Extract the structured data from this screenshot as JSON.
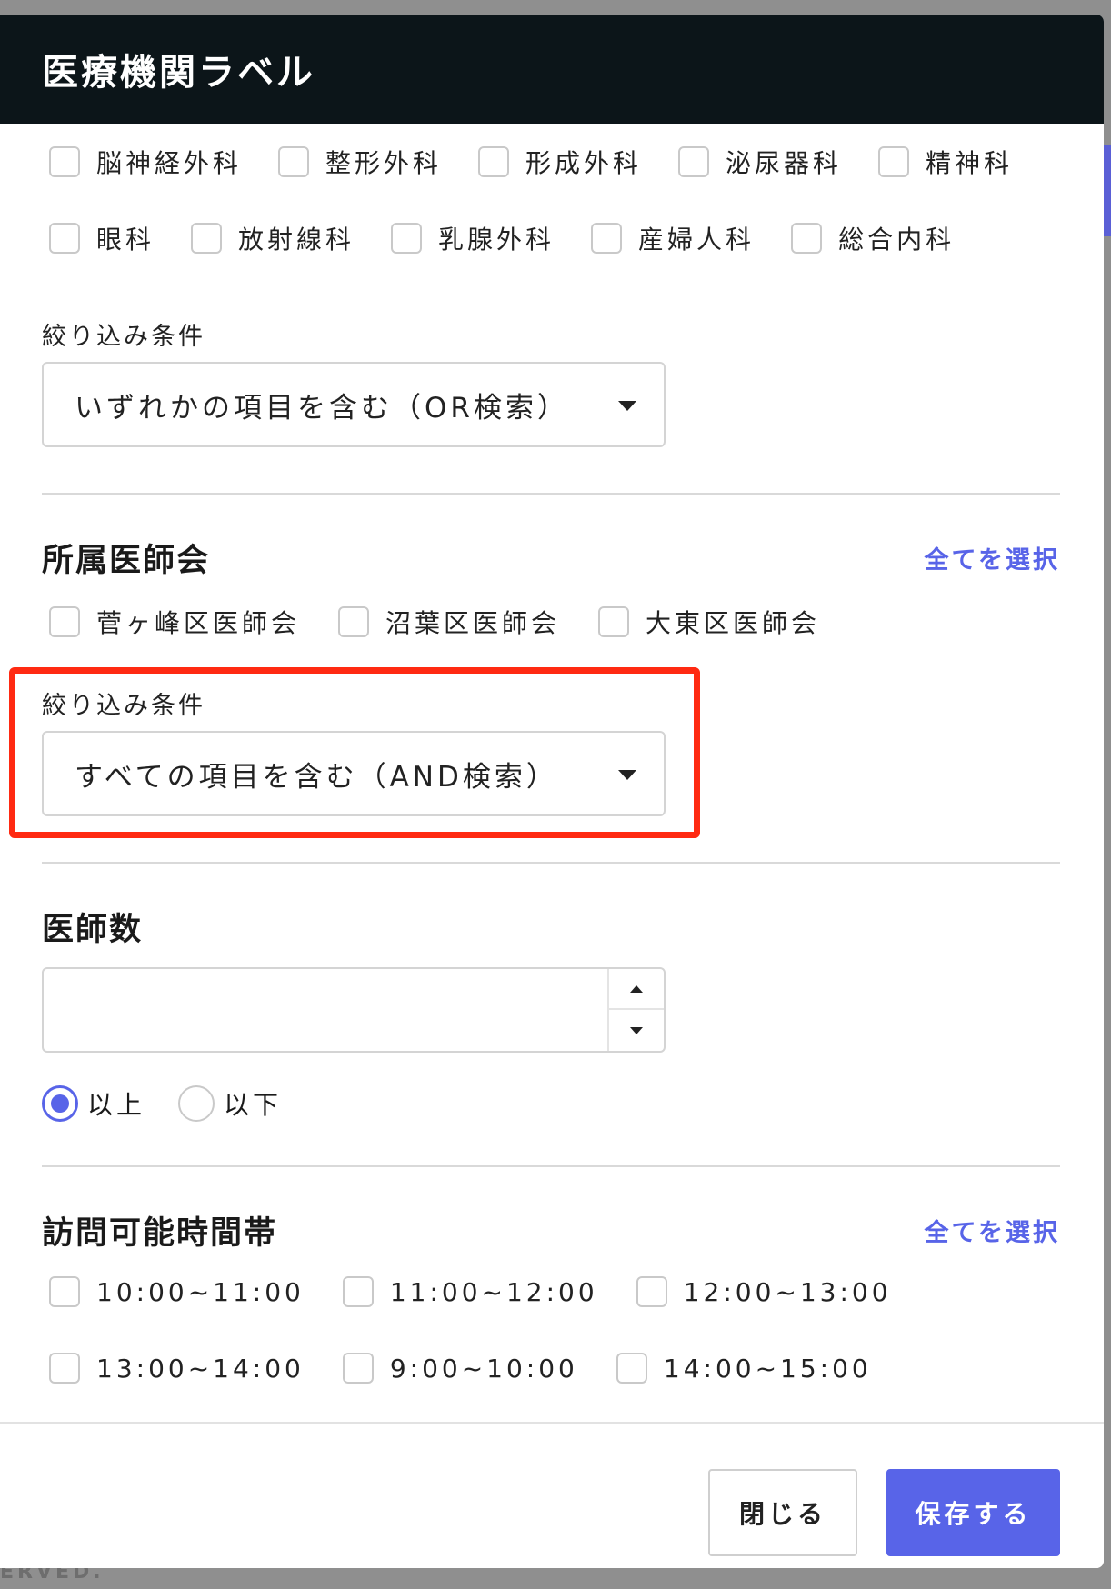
{
  "modal": {
    "title": "医療機関ラベル"
  },
  "departments": {
    "row1": [
      "脳神経外科",
      "整形外科",
      "形成外科",
      "泌尿器科",
      "精神科"
    ],
    "row2": [
      "眼科",
      "放射線科",
      "乳腺外科",
      "産婦人科",
      "総合内科"
    ],
    "filter_label": "絞り込み条件",
    "filter_value": "いずれかの項目を含む（OR検索）"
  },
  "medical_association": {
    "title": "所属医師会",
    "select_all": "全てを選択",
    "options": [
      "菅ヶ峰区医師会",
      "沼葉区医師会",
      "大東区医師会"
    ],
    "filter_label": "絞り込み条件",
    "filter_value": "すべての項目を含む（AND検索）"
  },
  "doctor_count": {
    "title": "医師数",
    "value": "",
    "radio_options": [
      "以上",
      "以下"
    ],
    "selected": "以上"
  },
  "visit_hours": {
    "title": "訪問可能時間帯",
    "select_all": "全てを選択",
    "row1": [
      "10:00~11:00",
      "11:00~12:00",
      "12:00~13:00"
    ],
    "row2": [
      "13:00~14:00",
      "9:00~10:00",
      "14:00~15:00"
    ]
  },
  "footer": {
    "close_label": "閉じる",
    "save_label": "保存する",
    "background_text": "ERVED."
  },
  "colors": {
    "header_bg": "#0c1519",
    "accent": "#5864e8",
    "highlight_border": "#ff2a12"
  }
}
